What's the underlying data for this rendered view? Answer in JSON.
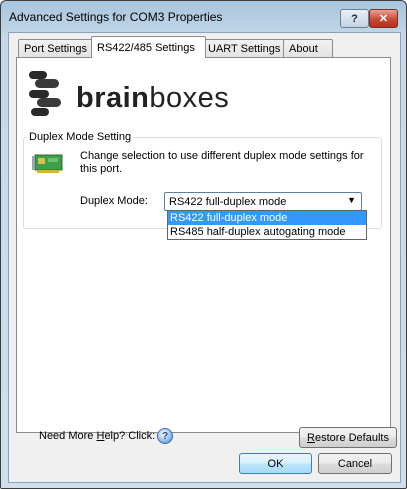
{
  "window": {
    "title": "Advanced Settings for COM3 Properties",
    "help_button": "?",
    "close_button": "✕"
  },
  "tabs": [
    {
      "label": "Port Settings",
      "active": false
    },
    {
      "label": "RS422/485 Settings",
      "active": true
    },
    {
      "label": "UART Settings",
      "active": false
    },
    {
      "label": "About",
      "active": false
    }
  ],
  "logo": {
    "brand_bold": "brain",
    "brand_light": "boxes"
  },
  "duplex_group": {
    "title": "Duplex Mode Setting",
    "description": "Change selection to use different duplex mode settings for this port.",
    "field_label": "Duplex Mode:",
    "selected_value": "RS422 full-duplex mode",
    "options": [
      "RS422 full-duplex mode",
      "RS485 half-duplex autogating mode"
    ]
  },
  "footer": {
    "help_prefix": "Need More ",
    "help_underlined": "H",
    "help_suffix": "elp? Click:",
    "restore_prefix": "",
    "restore_underlined": "R",
    "restore_suffix": "estore Defaults"
  },
  "dialog_buttons": {
    "ok": "OK",
    "cancel": "Cancel"
  },
  "colors": {
    "selection": "#3399ff",
    "ok_border": "#3c7fb1",
    "close_red": "#c54a35"
  },
  "icons": [
    "help-icon",
    "network-card-icon",
    "chevron-down-icon",
    "close-icon"
  ]
}
